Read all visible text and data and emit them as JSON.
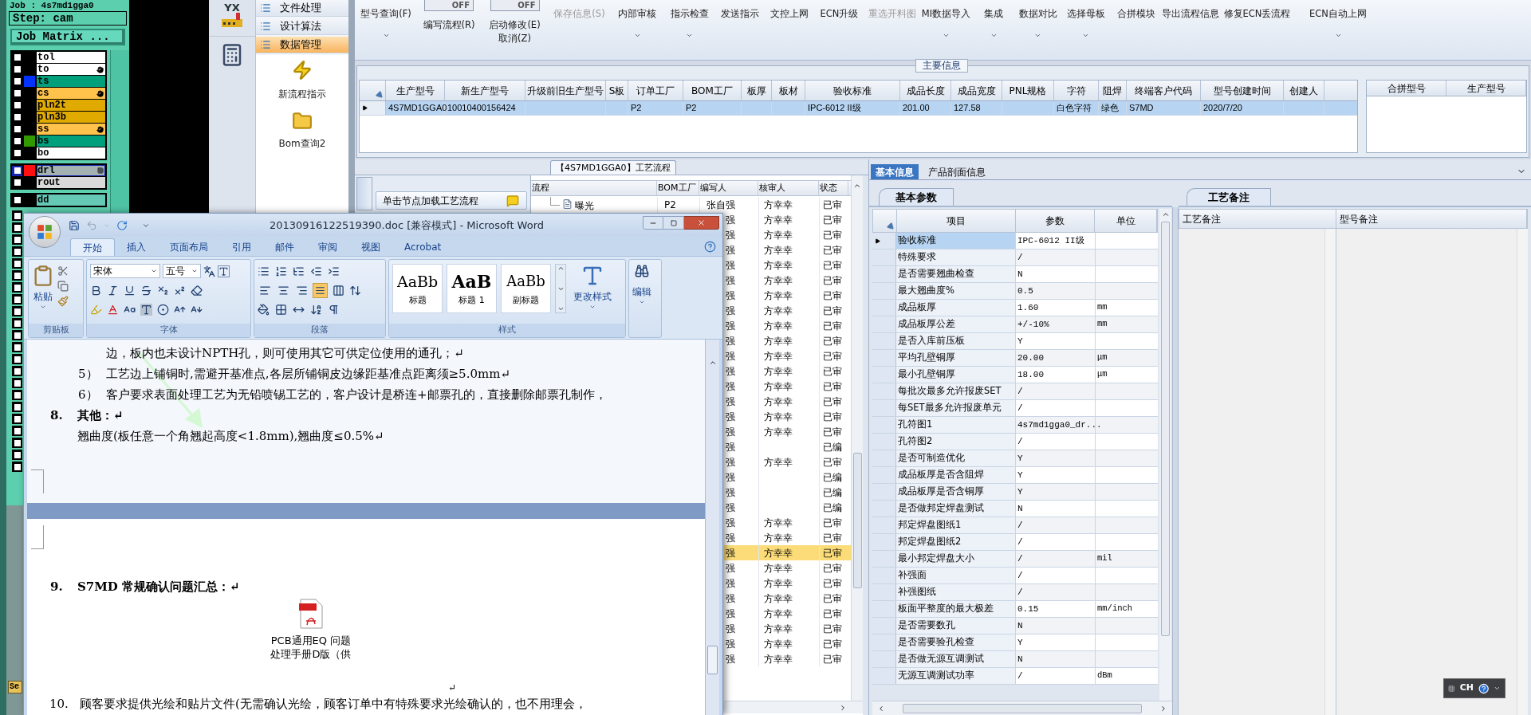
{
  "genesis": {
    "job": "Job : 4s7md1gga0",
    "step": "Step: cam",
    "matrix_button": "Job Matrix ...",
    "layer_groups": [
      {
        "layers": [
          {
            "name": "tol",
            "color": "#ffffff",
            "checked": false,
            "selected": false,
            "hand_mark": false,
            "grid_mark": false
          },
          {
            "name": "to",
            "color": "#ffffff",
            "checked": false,
            "selected": false,
            "hand_mark": true,
            "grid_mark": false
          },
          {
            "name": "ts",
            "color": "#00a07c",
            "checked": false,
            "selected": false,
            "hand_mark": false,
            "grid_mark": false,
            "swatch": {
              "color": "#0033ff"
            }
          },
          {
            "name": "cs",
            "color": "#ffc24a",
            "checked": false,
            "selected": false,
            "hand_mark": true,
            "grid_mark": false
          },
          {
            "name": "pln2t",
            "color": "#e0aa00",
            "checked": false,
            "selected": false,
            "hand_mark": false,
            "grid_mark": false
          },
          {
            "name": "pln3b",
            "color": "#e0aa00",
            "checked": false,
            "selected": false,
            "hand_mark": false,
            "grid_mark": false
          },
          {
            "name": "ss",
            "color": "#ffc24a",
            "checked": false,
            "selected": false,
            "hand_mark": true,
            "grid_mark": false
          },
          {
            "name": "bs",
            "color": "#00a07c",
            "checked": false,
            "selected": false,
            "hand_mark": false,
            "grid_mark": false,
            "swatch": {
              "color": "#339900"
            }
          },
          {
            "name": "bo",
            "color": "#ffffff",
            "checked": false,
            "selected": false,
            "hand_mark": false,
            "grid_mark": false
          }
        ]
      },
      {
        "layers": [
          {
            "name": "drl",
            "color": "#a4b2b2",
            "checked": false,
            "selected": true,
            "hand_mark": false,
            "grid_mark": true,
            "swatch": {
              "color": "#ff1010"
            }
          },
          {
            "name": "rout",
            "color": "#dadada",
            "checked": false,
            "selected": false,
            "hand_mark": false,
            "grid_mark": false
          }
        ]
      },
      {
        "layers": [
          {
            "name": "dd",
            "color": "#66c9b6",
            "checked": false,
            "selected": false,
            "hand_mark": false,
            "grid_mark": false
          }
        ]
      }
    ],
    "more_layers": [
      {
        "checked": false
      },
      {
        "checked": false
      },
      {
        "checked": false
      },
      {
        "checked": false
      },
      {
        "checked": false
      },
      {
        "checked": false
      },
      {
        "checked": false
      },
      {
        "checked": false
      },
      {
        "checked": false
      },
      {
        "checked": false
      },
      {
        "checked": false
      },
      {
        "checked": false
      },
      {
        "checked": false
      },
      {
        "checked": false
      },
      {
        "checked": false
      },
      {
        "checked": false
      },
      {
        "checked": false
      },
      {
        "checked": false
      },
      {
        "checked": false
      },
      {
        "checked": false
      },
      {
        "checked": false
      },
      {
        "checked": false
      }
    ],
    "side_button": "Se"
  },
  "nav": {
    "logo": "YX",
    "items": [
      {
        "label": "文件处理",
        "selected": false
      },
      {
        "label": "设计算法",
        "selected": false
      },
      {
        "label": "数据管理",
        "selected": true
      }
    ],
    "actions": [
      {
        "label": "新流程指示",
        "kind": "lightning"
      },
      {
        "label": "Bom查询2",
        "kind": "folder"
      }
    ]
  },
  "toolbar": [
    {
      "label": "型号查询(F)",
      "kind": "dropdown",
      "disabled": false
    },
    {
      "label": "编写流程(R)",
      "kind": "toggle",
      "toggle_text": "OFF",
      "on": false,
      "disabled": false
    },
    {
      "label": "启动修改(E)",
      "sublabel": "取消(Z)",
      "kind": "toggle",
      "toggle_text": "OFF",
      "on": false,
      "disabled": false
    },
    {
      "label": "保存信息(S)",
      "kind": "button",
      "disabled": true
    },
    {
      "label": "内部审核",
      "kind": "dropdown",
      "disabled": false
    },
    {
      "label": "指示检查",
      "kind": "dropdown",
      "disabled": false
    },
    {
      "label": "发送指示",
      "kind": "button",
      "disabled": false
    },
    {
      "label": "文控上网",
      "kind": "button",
      "disabled": false
    },
    {
      "label": "ECN升级",
      "kind": "button",
      "disabled": false
    },
    {
      "label": "重选开料图",
      "kind": "button",
      "disabled": true
    },
    {
      "label": "MI数据导入",
      "kind": "dropdown",
      "disabled": false
    },
    {
      "label": "集成",
      "kind": "dropdown",
      "disabled": false
    },
    {
      "label": "数据对比",
      "kind": "dropdown",
      "disabled": false
    },
    {
      "label": "选择母板",
      "kind": "dropdown",
      "disabled": false
    },
    {
      "label": "合拼模块",
      "kind": "button",
      "disabled": false
    },
    {
      "label": "导出流程信息",
      "kind": "button",
      "disabled": false
    },
    {
      "label": "修复ECN丢流程",
      "kind": "button",
      "disabled": false
    },
    {
      "label": "ECN自动上网",
      "kind": "dropdown",
      "disabled": false
    }
  ],
  "main_info": {
    "title": "主要信息",
    "columns": [
      "生产型号",
      "新生产型号",
      "升级前旧生产型号",
      "S板",
      "订单工厂",
      "BOM工厂",
      "板厚",
      "板材",
      "验收标准",
      "成品长度",
      "成品宽度",
      "PNL规格",
      "字符",
      "阻焊",
      "终端客户代码",
      "型号创建时间",
      "创建人"
    ],
    "rows": [
      {
        "selected": true,
        "cells": [
          "4S7MD1GGA0",
          "10010400156424",
          null,
          null,
          "P2",
          "P2",
          null,
          null,
          "IPC-6012 II级",
          "201.00",
          "127.58",
          null,
          "白色字符",
          "绿色",
          "S7MD",
          "2020/7/20",
          null
        ]
      }
    ],
    "merge_columns": [
      "合拼型号",
      "生产型号"
    ]
  },
  "process": {
    "tab": "【4S7MD1GGA0】工艺流程",
    "load_button": "单击节点加载工艺流程",
    "columns": [
      "流程",
      "BOM工厂",
      "编写人",
      "核审人",
      "状态"
    ],
    "rows": [
      {
        "name": "曝光",
        "bom": "P2",
        "writer": "张自强",
        "reviewer": "方幸幸",
        "status": "已审",
        "selected": false
      },
      {
        "writer": "强",
        "reviewer": "方幸幸",
        "status": "已审",
        "selected": false
      },
      {
        "writer": "强",
        "reviewer": "方幸幸",
        "status": "已审",
        "selected": false
      },
      {
        "writer": "强",
        "reviewer": "方幸幸",
        "status": "已审",
        "selected": false
      },
      {
        "writer": "强",
        "reviewer": "方幸幸",
        "status": "已审",
        "selected": false
      },
      {
        "writer": "强",
        "reviewer": "方幸幸",
        "status": "已审",
        "selected": false
      },
      {
        "writer": "强",
        "reviewer": "方幸幸",
        "status": "已审",
        "selected": false
      },
      {
        "writer": "强",
        "reviewer": "方幸幸",
        "status": "已审",
        "selected": false
      },
      {
        "writer": "强",
        "reviewer": "方幸幸",
        "status": "已审",
        "selected": false
      },
      {
        "writer": "强",
        "reviewer": "方幸幸",
        "status": "已审",
        "selected": false
      },
      {
        "writer": "强",
        "reviewer": "方幸幸",
        "status": "已审",
        "selected": false
      },
      {
        "writer": "强",
        "reviewer": "方幸幸",
        "status": "已审",
        "selected": false
      },
      {
        "writer": "强",
        "reviewer": "方幸幸",
        "status": "已审",
        "selected": false
      },
      {
        "writer": "强",
        "reviewer": "方幸幸",
        "status": "已审",
        "selected": false
      },
      {
        "writer": "强",
        "reviewer": "方幸幸",
        "status": "已审",
        "selected": false
      },
      {
        "writer": "强",
        "reviewer": "方幸幸",
        "status": "已审",
        "selected": false
      },
      {
        "writer": "强",
        "status": "已编",
        "selected": false
      },
      {
        "writer": "强",
        "reviewer": "方幸幸",
        "status": "已审",
        "selected": false
      },
      {
        "writer": "强",
        "status": "已编",
        "selected": false
      },
      {
        "writer": "强",
        "status": "已编",
        "selected": false
      },
      {
        "writer": "强",
        "status": "已编",
        "selected": false
      },
      {
        "writer": "强",
        "reviewer": "方幸幸",
        "status": "已审",
        "selected": false
      },
      {
        "writer": "强",
        "reviewer": "方幸幸",
        "status": "已审",
        "selected": false
      },
      {
        "writer": "强",
        "reviewer": "方幸幸",
        "status": "已审",
        "selected": true
      },
      {
        "writer": "强",
        "reviewer": "方幸幸",
        "status": "已审",
        "selected": false
      },
      {
        "writer": "强",
        "reviewer": "方幸幸",
        "status": "已审",
        "selected": false
      },
      {
        "writer": "强",
        "reviewer": "方幸幸",
        "status": "已审",
        "selected": false
      },
      {
        "writer": "强",
        "reviewer": "方幸幸",
        "status": "已审",
        "selected": false
      },
      {
        "writer": "强",
        "reviewer": "方幸幸",
        "status": "已审",
        "selected": false
      },
      {
        "writer": "强",
        "reviewer": "方幸幸",
        "status": "已审",
        "selected": false
      },
      {
        "writer": "强",
        "reviewer": "方幸幸",
        "status": "已审",
        "selected": false
      }
    ]
  },
  "detail": {
    "tabs": [
      {
        "label": "基本信息",
        "selected": true
      },
      {
        "label": "产品剖面信息",
        "selected": false
      }
    ],
    "subtab": "基本参数",
    "columns": [
      "项目",
      "参数",
      "单位"
    ],
    "rows": [
      {
        "item": "验收标准",
        "value": "IPC-6012 II级",
        "selected": true
      },
      {
        "item": "特殊要求",
        "value": "/",
        "selected": false
      },
      {
        "item": "是否需要翘曲检查",
        "value": "N",
        "selected": false
      },
      {
        "item": "最大翘曲度%",
        "value": "0.5",
        "selected": false
      },
      {
        "item": "成品板厚",
        "value": "1.60",
        "unit": "mm",
        "selected": false
      },
      {
        "item": "成品板厚公差",
        "value": "+/-10%",
        "unit": "mm",
        "selected": false
      },
      {
        "item": "是否入库前压板",
        "value": "Y",
        "selected": false
      },
      {
        "item": "平均孔壁铜厚",
        "value": "20.00",
        "unit": "μm",
        "selected": false
      },
      {
        "item": "最小孔壁铜厚",
        "value": "18.00",
        "unit": "μm",
        "selected": false
      },
      {
        "item": "每批次最多允许报废SET",
        "value": "/",
        "selected": false
      },
      {
        "item": "每SET最多允许报废单元",
        "value": "/",
        "selected": false
      },
      {
        "item": "孔符图1",
        "value": "4s7md1gga0_dr...",
        "selected": false
      },
      {
        "item": "孔符图2",
        "value": "/",
        "selected": false
      },
      {
        "item": "是否可制造优化",
        "value": "Y",
        "selected": false
      },
      {
        "item": "成品板厚是否含阻焊",
        "value": "Y",
        "selected": false
      },
      {
        "item": "成品板厚是否含铜厚",
        "value": "Y",
        "selected": false
      },
      {
        "item": "是否做邦定焊盘测试",
        "value": "N",
        "selected": false
      },
      {
        "item": "邦定焊盘图纸1",
        "value": "/",
        "selected": false
      },
      {
        "item": "邦定焊盘图纸2",
        "value": "/",
        "selected": false
      },
      {
        "item": "最小邦定焊盘大小",
        "value": "/",
        "unit": "mil",
        "selected": false
      },
      {
        "item": "补强面",
        "value": "/",
        "selected": false
      },
      {
        "item": "补强图纸",
        "value": "/",
        "selected": false
      },
      {
        "item": "板面平整度的最大极差",
        "value": "0.15",
        "unit": "mm/inch",
        "selected": false
      },
      {
        "item": "是否需要数孔",
        "value": "N",
        "selected": false
      },
      {
        "item": "是否需要验孔检查",
        "value": "Y",
        "selected": false
      },
      {
        "item": "是否做无源互调测试",
        "value": "N",
        "selected": false
      },
      {
        "item": "无源互调测试功率",
        "value": "/",
        "unit": "dBm",
        "selected": false
      }
    ]
  },
  "remarks": {
    "tab": "工艺备注",
    "columns": [
      "工艺备注",
      "型号备注"
    ]
  },
  "language_bar": {
    "label": "CH"
  },
  "word": {
    "title": "20130916122519390.doc [兼容模式] - Microsoft Word",
    "tabs": [
      {
        "label": "开始",
        "selected": true
      },
      {
        "label": "插入",
        "selected": false
      },
      {
        "label": "页面布局",
        "selected": false
      },
      {
        "label": "引用",
        "selected": false
      },
      {
        "label": "邮件",
        "selected": false
      },
      {
        "label": "审阅",
        "selected": false
      },
      {
        "label": "视图",
        "selected": false
      },
      {
        "label": "Acrobat",
        "selected": false
      }
    ],
    "paste": "粘贴",
    "font_name": "宋体",
    "font_size": "五号",
    "alignments": [
      {
        "kind": "left",
        "selected": false
      },
      {
        "kind": "center",
        "selected": false
      },
      {
        "kind": "right",
        "selected": false
      },
      {
        "kind": "justify",
        "selected": true
      },
      {
        "kind": "distributed",
        "selected": false
      }
    ],
    "styles": [
      {
        "sample": "AaBb",
        "label": "标题",
        "kind": "title"
      },
      {
        "sample": "AaB",
        "label": "标题 1",
        "kind": "heading"
      },
      {
        "sample": "AaBb",
        "label": "副标题",
        "kind": "subtitle"
      }
    ],
    "change_styles": "更改样式",
    "edit": "编辑",
    "groups": [
      "剪贴板",
      "字体",
      "段落",
      "样式"
    ],
    "pages": [
      {
        "paragraphs": [
          {
            "kind": "continuation",
            "text": "边，板内也未设计NPTH孔，则可使用其它可供定位使用的通孔；↵"
          },
          {
            "kind": "item",
            "number": "5）",
            "text": "工艺边上铺铜时,需避开基准点,各层所铺铜皮边缘距基准点距离须≥5.0mm↵"
          },
          {
            "kind": "item",
            "number": "6）",
            "text": "客户要求表面处理工艺为无铅喷锡工艺的，客户设计是桥连+邮票孔的，直接删除邮票孔制作，"
          },
          {
            "kind": "heading",
            "number": "8.",
            "text": "其他：↵"
          },
          {
            "kind": "body",
            "text": "翘曲度(板任意一个角翘起高度<1.8mm),翘曲度≤0.5%↵"
          }
        ]
      },
      {
        "paragraphs": [
          {
            "kind": "heading",
            "number": "9.",
            "text": "S7MD 常规确认问题汇总：↵"
          },
          {
            "kind": "attachment",
            "caption": [
              "PCB通用EQ 问题",
              "处理手册D版（供"
            ]
          },
          {
            "kind": "mark",
            "text": "↵"
          },
          {
            "kind": "numbered",
            "number": "10.",
            "text": "顾客要求提供光绘和贴片文件(无需确认光绘，顾客订单中有特殊要求光绘确认的，也不用理会，"
          }
        ]
      }
    ]
  }
}
